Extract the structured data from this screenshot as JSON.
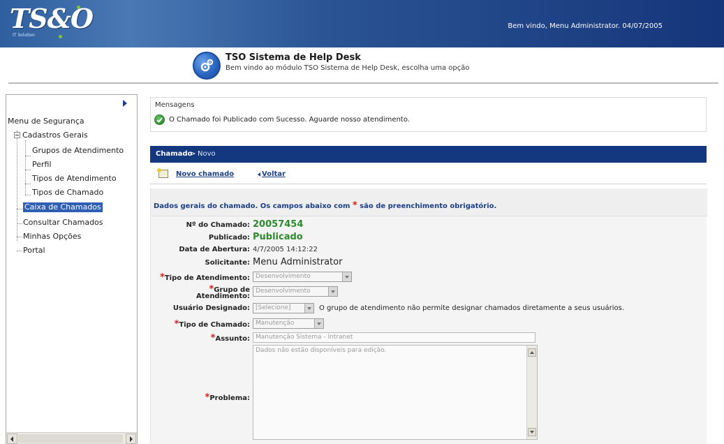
{
  "header": {
    "logo_text": "TS&O",
    "logo_sub": "IT Solution",
    "welcome": "Bem vindo, Menu Administrator. 04/07/2005",
    "brand_color": "#14387f"
  },
  "app": {
    "title": "TSO Sistema de Help Desk",
    "subtitle": "Bem vindo ao módulo TSO Sistema de Help Desk, escolha uma opção",
    "icon": "gears-icon"
  },
  "sidebar": {
    "items": [
      {
        "label": "Menu de Segurança"
      },
      {
        "label": "Cadastros Gerais"
      },
      {
        "label": "Grupos de Atendimento"
      },
      {
        "label": "Perfil"
      },
      {
        "label": "Tipos de Atendimento"
      },
      {
        "label": "Tipos de Chamado"
      },
      {
        "label": "Caixa de Chamados"
      },
      {
        "label": "Consultar Chamados"
      },
      {
        "label": "Minhas Opções"
      },
      {
        "label": "Portal"
      }
    ],
    "selected": "Caixa de Chamados"
  },
  "messages": {
    "label": "Mensagens",
    "text": "O Chamado foi Publicado com Sucesso. Aguarde nosso atendimento."
  },
  "breadcrumb": {
    "section": "Chamado",
    "separator": ">",
    "page": "Novo"
  },
  "toolbar": {
    "new_label": "Novo chamado",
    "back_label": "Voltar"
  },
  "form": {
    "header_prefix": "Dados gerais do chamado. Os campos abaixo com",
    "header_required_mark": "*",
    "header_suffix": "são de preenchimento obrigatório.",
    "numero_label": "Nº do Chamado:",
    "numero_value": "20057454",
    "publicado_label": "Publicado:",
    "publicado_value": "Publicado",
    "abertura_label": "Data de Abertura:",
    "abertura_value": "4/7/2005 14:12:22",
    "solicitante_label": "Solicitante:",
    "solicitante_value": "Menu Administrator",
    "tipo_atendimento_label": "Tipo de Atendimento:",
    "tipo_atendimento_value": "Desenvolvimento",
    "grupo_label_1": "Grupo de",
    "grupo_label_2": "Atendimento:",
    "grupo_value": "Desenvolvimento",
    "usuario_label": "Usuário Designado:",
    "usuario_value": "[Selecione]",
    "usuario_note": "O grupo de atendimento não permite designar chamados diretamente a seus usuários.",
    "tipo_chamado_label": "Tipo de Chamado:",
    "tipo_chamado_value": "Manutenção",
    "assunto_label": "Assunto:",
    "assunto_value": "Manutenção Sistema - Intranet",
    "problema_label": "Problema:",
    "problema_value": "Dados não estão disponíveis para edição.",
    "required_mark": "*"
  }
}
